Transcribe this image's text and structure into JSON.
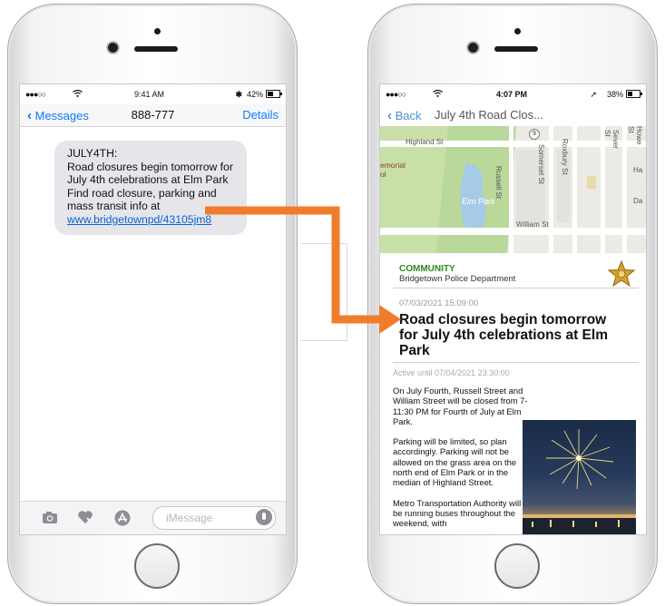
{
  "left_phone": {
    "status": {
      "signal": "●●●○○",
      "wifi": "wifi-icon",
      "time": "9:41 AM",
      "bluetooth": "bluetooth-icon",
      "battery": "42%"
    },
    "nav": {
      "back_label": "Messages",
      "title": "888-777",
      "details_label": "Details"
    },
    "message": {
      "line1": "JULY4TH:",
      "line2": "Road closures begin tomorrow for July 4th celebrations at Elm Park",
      "line3": "Find road closure, parking and mass transit info at",
      "link": "www.bridgetownpd/43105jm8"
    },
    "input_placeholder": "iMessage",
    "toolbar_icons": [
      "camera-icon",
      "heart-digital-touch-icon",
      "app-store-icon",
      "mic-icon"
    ]
  },
  "right_phone": {
    "status": {
      "signal": "●●●○○",
      "wifi": "wifi-icon",
      "time": "4:07 PM",
      "location": "location-icon",
      "battery": "38%"
    },
    "nav": {
      "back_label": "Back",
      "title": "July 4th Road Clos..."
    },
    "map": {
      "streets": [
        "Highland St",
        "Russell St",
        "Somerset St",
        "Roxbury St",
        "Sever St",
        "Howe St",
        "William St"
      ],
      "park": "Elm Park",
      "route": "9",
      "partial_labels": [
        "emorial",
        "ol",
        "Ha",
        "Da"
      ]
    },
    "alert": {
      "category": "COMMUNITY",
      "agency": "Bridgetown Police Department",
      "timestamp": "07/03/2021  15:09:00",
      "headline": "Road closures begin tomorrow for July 4th celebrations at Elm Park",
      "active_until": "Active until 07/04/2021 23:30:00",
      "paragraphs": [
        "On July Fourth, Russell Street and William Street will be closed from 7-11:30 PM for Fourth of July at Elm Park.",
        "Parking will be limited, so plan accordingly. Parking will not be allowed on the grass area on the north end of Elm Park or in the median of Highland Street.",
        "Metro Transportation Authority will be running buses throughout the weekend, with"
      ]
    }
  },
  "colors": {
    "ios_blue": "#0a7aff",
    "arrow": "#f07d2c",
    "community_green": "#2b8a1f",
    "bubble": "#e5e5ea"
  }
}
